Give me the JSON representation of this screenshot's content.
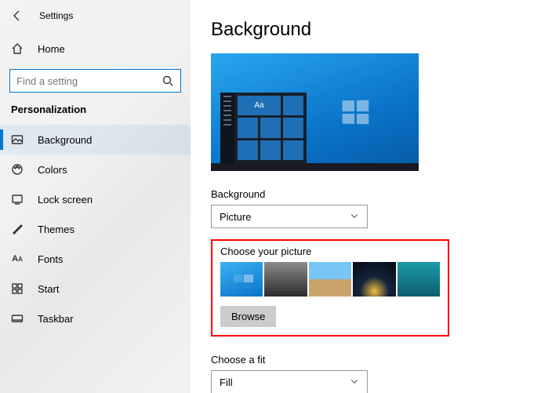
{
  "header": {
    "title": "Settings"
  },
  "home_label": "Home",
  "search": {
    "placeholder": "Find a setting"
  },
  "section": "Personalization",
  "nav": [
    {
      "label": "Background"
    },
    {
      "label": "Colors"
    },
    {
      "label": "Lock screen"
    },
    {
      "label": "Themes"
    },
    {
      "label": "Fonts"
    },
    {
      "label": "Start"
    },
    {
      "label": "Taskbar"
    }
  ],
  "main": {
    "title": "Background",
    "preview_tile_text": "Aa",
    "bg_label": "Background",
    "bg_value": "Picture",
    "choose_label": "Choose your picture",
    "browse": "Browse",
    "fit_label": "Choose a fit",
    "fit_value": "Fill"
  }
}
